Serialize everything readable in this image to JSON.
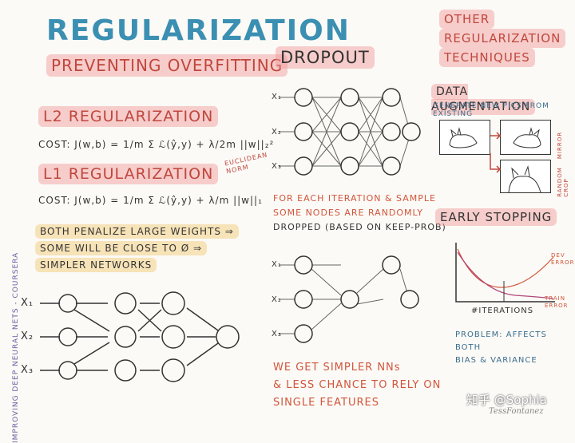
{
  "title": "REGULARIZATION",
  "subtitle": "PREVENTING OVERFITTING",
  "side_label": "IMPROVING DEEP NEURAL NETS - COURSERA",
  "l2": {
    "heading": "L2 REGULARIZATION",
    "cost": "COST: J(w,b) = 1/m Σ ℒ(ŷ,y) + λ/2m ||w||₂²",
    "note": "EUCLIDEAN NORM"
  },
  "l1": {
    "heading": "L1 REGULARIZATION",
    "cost": "COST: J(w,b) = 1/m Σ ℒ(ŷ,y) + λ/m ||w||₁"
  },
  "both": {
    "lines": [
      "BOTH PENALIZE LARGE WEIGHTS ⇒",
      "SOME WILL BE CLOSE TO Ø ⇒",
      "SIMPLER NETWORKS"
    ]
  },
  "inputs": [
    "X₁",
    "X₂",
    "X₃"
  ],
  "dropout": {
    "heading": "DROPOUT",
    "note": [
      "FOR EACH ITERATION & SAMPLE",
      "SOME NODES ARE RANDOMLY",
      "DROPPED (BASED ON KEEP-PROB)"
    ],
    "conclusion": [
      "WE GET SIMPLER NNs",
      "& LESS CHANCE TO RELY ON",
      "SINGLE FEATURES"
    ]
  },
  "other": {
    "heading": [
      "OTHER",
      "REGULARIZATION",
      "TECHNIQUES"
    ],
    "augmentation": {
      "heading": "DATA AUGMENTATION",
      "desc": "GENERATE NEW PICS FROM EXISTING",
      "mirror": "MIRROR",
      "random_crop": "RANDOM CROP"
    },
    "early_stopping": {
      "heading": "EARLY STOPPING",
      "dev_error": "DEV ERROR",
      "train_error": "TRAIN ERROR",
      "xlabel": "#ITERATIONS",
      "problem": [
        "PROBLEM: AFFECTS BOTH",
        "BIAS & VARIANCE"
      ]
    }
  },
  "watermark": "知乎 @Sophia",
  "signature": "TessFontanez",
  "colors": {
    "blue": "#3b8fb2",
    "red": "#d2553b",
    "pink": "#e98c8c",
    "yellow": "#f2cd86"
  }
}
